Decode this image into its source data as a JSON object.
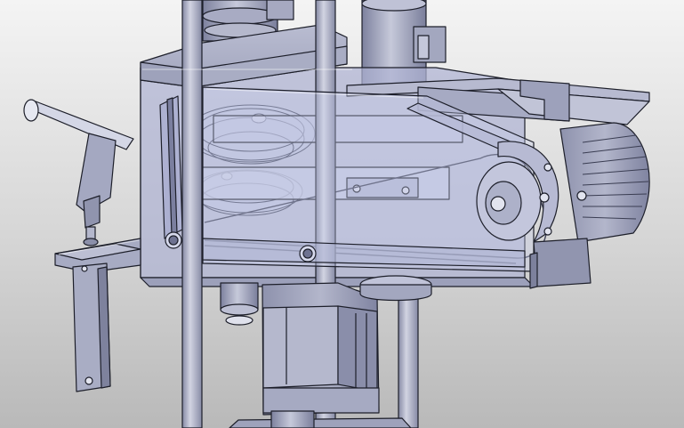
{
  "app": {
    "view": "3d-model-viewport",
    "background_top": "#f4f4f4",
    "background_bottom": "#b9b9b9"
  },
  "model": {
    "body_color": "#9b9fb6",
    "light_color": "#c9cbdc",
    "dark_color": "#6e7291",
    "edge_color": "#1d1f2a",
    "glass_color": "#b8bedf"
  }
}
